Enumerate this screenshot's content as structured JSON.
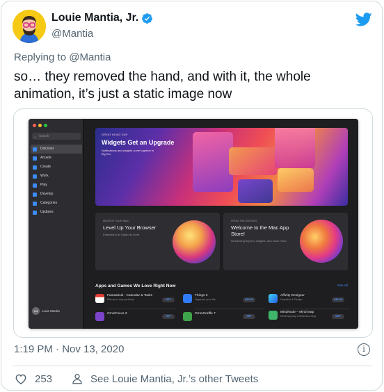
{
  "tweet": {
    "display_name": "Louie Mantia, Jr.",
    "handle": "@Mantia",
    "replying_prefix": "Replying to",
    "replying_to": "@Mantia",
    "text": "so… they removed the hand, and with it, the whole animation, it’s just a static image now",
    "timestamp": "1:19 PM · Nov 13, 2020",
    "like_count": "253",
    "other_tweets_label": "See Louie Mantia, Jr.’s other Tweets"
  },
  "colors": {
    "twitter_blue": "#1d9bf0",
    "avatar_bg": "#f6c915",
    "app_accent": "#3d8bf5"
  },
  "media": {
    "search_placeholder": "Search",
    "nav_items": [
      "Discover",
      "Arcade",
      "Create",
      "Work",
      "Play",
      "Develop",
      "Categories",
      "Updates"
    ],
    "account_initials": "LM",
    "account_name": "Louie Mantia",
    "hero": {
      "eyebrow": "GREAT IN BIG SUR",
      "title": "Widgets Get an Upgrade",
      "subtitle": "Notifications and widgets come together in Big Sur."
    },
    "panel_left": {
      "eyebrow": "MASTER YOUR MAC",
      "title": "Level Up Your Browser",
      "subtitle": "Extensions let Safari do more."
    },
    "panel_right": {
      "eyebrow": "FROM THE EDITORS",
      "title": "Welcome to the Mac App Store!",
      "subtitle": "Introducing Big Sur, widgets, and much more."
    },
    "section_title": "Apps and Games We Love Right Now",
    "see_all": "See All",
    "apps": [
      {
        "name": "Fantastical - Calendar & Tasks",
        "category": "Plan your day perfectly",
        "action": "GET"
      },
      {
        "name": "Things 3",
        "category": "Organize your life",
        "action": "$49.99"
      },
      {
        "name": "Affinity Designer",
        "category": "Graphics & Design",
        "action": "$49.99"
      },
      {
        "name": "OmniFocus 3",
        "category": "",
        "action": "GET"
      },
      {
        "name": "OmniGraffle 7",
        "category": "",
        "action": "GET"
      },
      {
        "name": "MindNode – Mind Map",
        "category": "Mindmapping & Brainstorming",
        "action": "GET"
      }
    ]
  }
}
